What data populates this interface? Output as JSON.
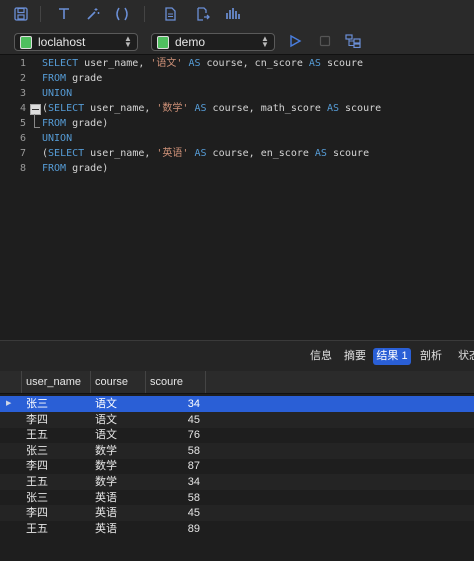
{
  "toolbar": {
    "icons": [
      "save-icon",
      "format-icon",
      "beautify-icon",
      "parentheses-icon",
      "document-icon",
      "export-icon",
      "explain-icon"
    ]
  },
  "connection": {
    "selected": "loclahost",
    "icon_color": "#4fbf5f"
  },
  "database": {
    "selected": "demo",
    "icon_color": "#4fbf5f"
  },
  "run_controls": {
    "icons": [
      "run-icon",
      "stop-icon",
      "explain-plan-icon"
    ]
  },
  "editor": {
    "lines": [
      {
        "num": "1",
        "tokens": [
          {
            "t": "SELECT",
            "k": "kw"
          },
          {
            "t": " user_name, ",
            "k": ""
          },
          {
            "t": "'语文'",
            "k": "str"
          },
          {
            "t": " ",
            "k": ""
          },
          {
            "t": "AS",
            "k": "kw"
          },
          {
            "t": " course, cn_score ",
            "k": ""
          },
          {
            "t": "AS",
            "k": "kw"
          },
          {
            "t": " scoure",
            "k": ""
          }
        ]
      },
      {
        "num": "2",
        "tokens": [
          {
            "t": "FROM",
            "k": "kw"
          },
          {
            "t": " grade",
            "k": ""
          }
        ]
      },
      {
        "num": "3",
        "tokens": [
          {
            "t": "UNION",
            "k": "kw"
          }
        ]
      },
      {
        "num": "4",
        "tokens": [
          {
            "t": "(",
            "k": ""
          },
          {
            "t": "SELECT",
            "k": "kw"
          },
          {
            "t": " user_name, ",
            "k": ""
          },
          {
            "t": "'数学'",
            "k": "str"
          },
          {
            "t": " ",
            "k": ""
          },
          {
            "t": "AS",
            "k": "kw"
          },
          {
            "t": " course, math_score ",
            "k": ""
          },
          {
            "t": "AS",
            "k": "kw"
          },
          {
            "t": " scoure",
            "k": ""
          }
        ]
      },
      {
        "num": "5",
        "tokens": [
          {
            "t": "FROM",
            "k": "kw"
          },
          {
            "t": " grade)",
            "k": ""
          }
        ]
      },
      {
        "num": "6",
        "tokens": [
          {
            "t": "UNION",
            "k": "kw"
          }
        ]
      },
      {
        "num": "7",
        "tokens": [
          {
            "t": "(",
            "k": ""
          },
          {
            "t": "SELECT",
            "k": "kw"
          },
          {
            "t": " user_name, ",
            "k": ""
          },
          {
            "t": "'英语'",
            "k": "str"
          },
          {
            "t": " ",
            "k": ""
          },
          {
            "t": "AS",
            "k": "kw"
          },
          {
            "t": " course, en_score ",
            "k": ""
          },
          {
            "t": "AS",
            "k": "kw"
          },
          {
            "t": " scoure",
            "k": ""
          }
        ]
      },
      {
        "num": "8",
        "tokens": [
          {
            "t": "FROM",
            "k": "kw"
          },
          {
            "t": " grade)",
            "k": ""
          }
        ]
      }
    ]
  },
  "result_tabs": [
    {
      "label": "信息",
      "active": false
    },
    {
      "label": "摘要",
      "active": false
    },
    {
      "label": "结果 1",
      "active": true
    },
    {
      "label": "剖析",
      "active": false
    },
    {
      "label": "状态",
      "active": false
    }
  ],
  "grid": {
    "columns": [
      "user_name",
      "course",
      "scoure"
    ],
    "rows": [
      [
        "张三",
        "语文",
        "34"
      ],
      [
        "李四",
        "语文",
        "45"
      ],
      [
        "王五",
        "语文",
        "76"
      ],
      [
        "张三",
        "数学",
        "58"
      ],
      [
        "李四",
        "数学",
        "87"
      ],
      [
        "王五",
        "数学",
        "34"
      ],
      [
        "张三",
        "英语",
        "58"
      ],
      [
        "李四",
        "英语",
        "45"
      ],
      [
        "王五",
        "英语",
        "89"
      ]
    ],
    "selected_row": 0,
    "row_marker": "▶"
  },
  "colors": {
    "accent": "#2a5fd6",
    "keyword": "#569cd6",
    "string": "#ce9178",
    "icon": "#6b8fd6"
  }
}
